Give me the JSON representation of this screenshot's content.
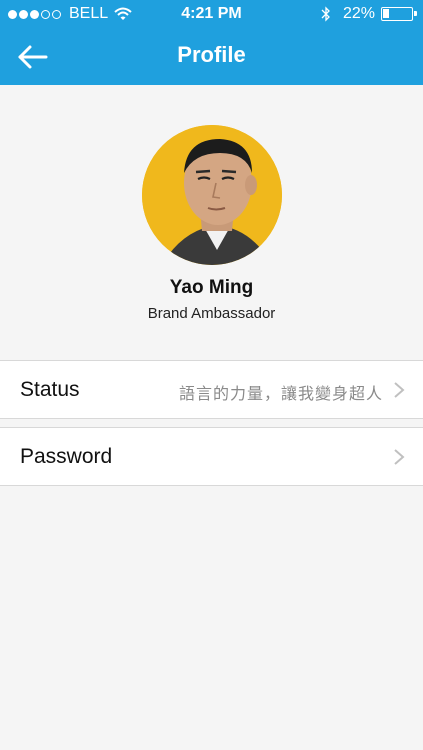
{
  "status_bar": {
    "carrier": "BELL",
    "time": "4:21 PM",
    "battery_percent": "22%",
    "battery_level": 0.22,
    "signal_bars_filled": 3,
    "signal_bars_total": 5
  },
  "nav": {
    "title": "Profile",
    "back_icon": "back-arrow-icon"
  },
  "profile": {
    "name": "Yao Ming",
    "role": "Brand Ambassador",
    "avatar_bg_color": "#f0b81c"
  },
  "settings": {
    "status": {
      "label": "Status",
      "value": "語言的力量，讓我變身超人"
    },
    "password": {
      "label": "Password"
    }
  },
  "colors": {
    "accent": "#1fa0de",
    "background": "#f5f5f5"
  }
}
